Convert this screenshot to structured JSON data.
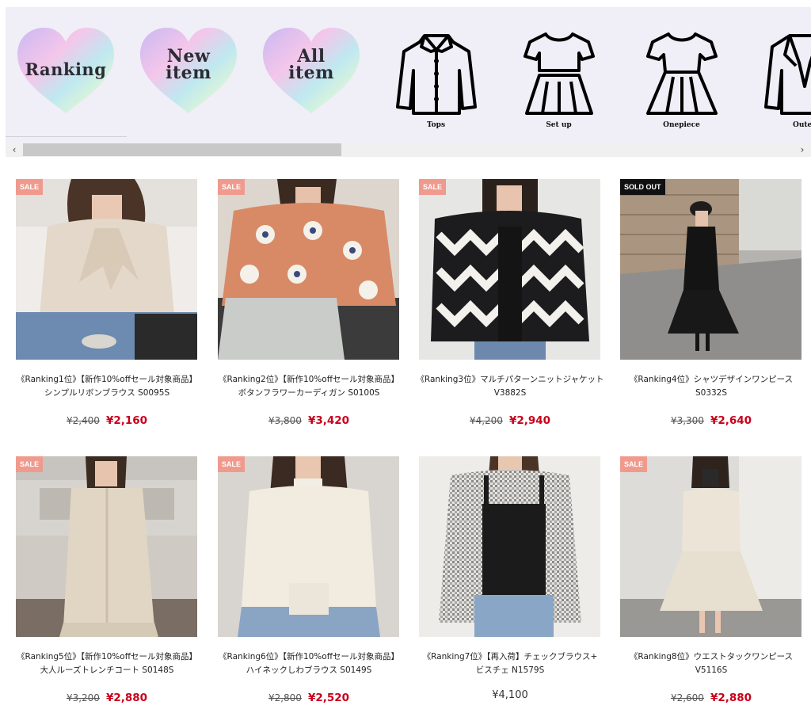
{
  "hearts": [
    {
      "line1": "Ranking",
      "line2": ""
    },
    {
      "line1": "New",
      "line2": "item"
    },
    {
      "line1": "All",
      "line2": "item"
    }
  ],
  "categories": [
    {
      "label": "Tops",
      "icon": "shirt-icon"
    },
    {
      "label": "Set up",
      "icon": "setup-icon"
    },
    {
      "label": "Onepiece",
      "icon": "dress-icon"
    },
    {
      "label": "Outer",
      "icon": "jacket-icon"
    }
  ],
  "scrollbar": {
    "left": "‹",
    "right": "›"
  },
  "products": [
    {
      "badge": "SALE",
      "title1": "《Ranking1位》【新作10%offセール対象商品】",
      "title2": "シンプルリボンブラウス S0095S",
      "old_price": "¥2,400",
      "price": "¥2,160"
    },
    {
      "badge": "SALE",
      "title1": "《Ranking2位》【新作10%offセール対象商品】",
      "title2": "ボタンフラワーカーディガン S0100S",
      "old_price": "¥3,800",
      "price": "¥3,420"
    },
    {
      "badge": "SALE",
      "title1": "《Ranking3位》マルチパターンニットジャケット",
      "title2": "V3882S",
      "old_price": "¥4,200",
      "price": "¥2,940"
    },
    {
      "badge": "SOLD OUT",
      "title1": "《Ranking4位》シャツデザインワンピース",
      "title2": "S0332S",
      "old_price": "¥3,300",
      "price": "¥2,640"
    },
    {
      "badge": "SALE",
      "title1": "《Ranking5位》【新作10%offセール対象商品】",
      "title2": "大人ルーズトレンチコート S0148S",
      "old_price": "¥3,200",
      "price": "¥2,880"
    },
    {
      "badge": "SALE",
      "title1": "《Ranking6位》【新作10%offセール対象商品】",
      "title2": "ハイネックしわブラウス S0149S",
      "old_price": "¥2,800",
      "price": "¥2,520"
    },
    {
      "badge": "",
      "title1": "《Ranking7位》【再入荷】チェックブラウス+",
      "title2": "ビスチェ N1579S",
      "old_price": "",
      "price": "¥4,100"
    },
    {
      "badge": "SALE",
      "title1": "《Ranking8位》ウエストタックワンピース",
      "title2": "V5116S",
      "old_price": "¥2,600",
      "price": "¥2,880"
    }
  ],
  "colors": {
    "sale_badge": "#f09a8e",
    "sold_badge": "#111111",
    "price_red": "#c8001b",
    "strip_bg": "#f0eef6"
  }
}
